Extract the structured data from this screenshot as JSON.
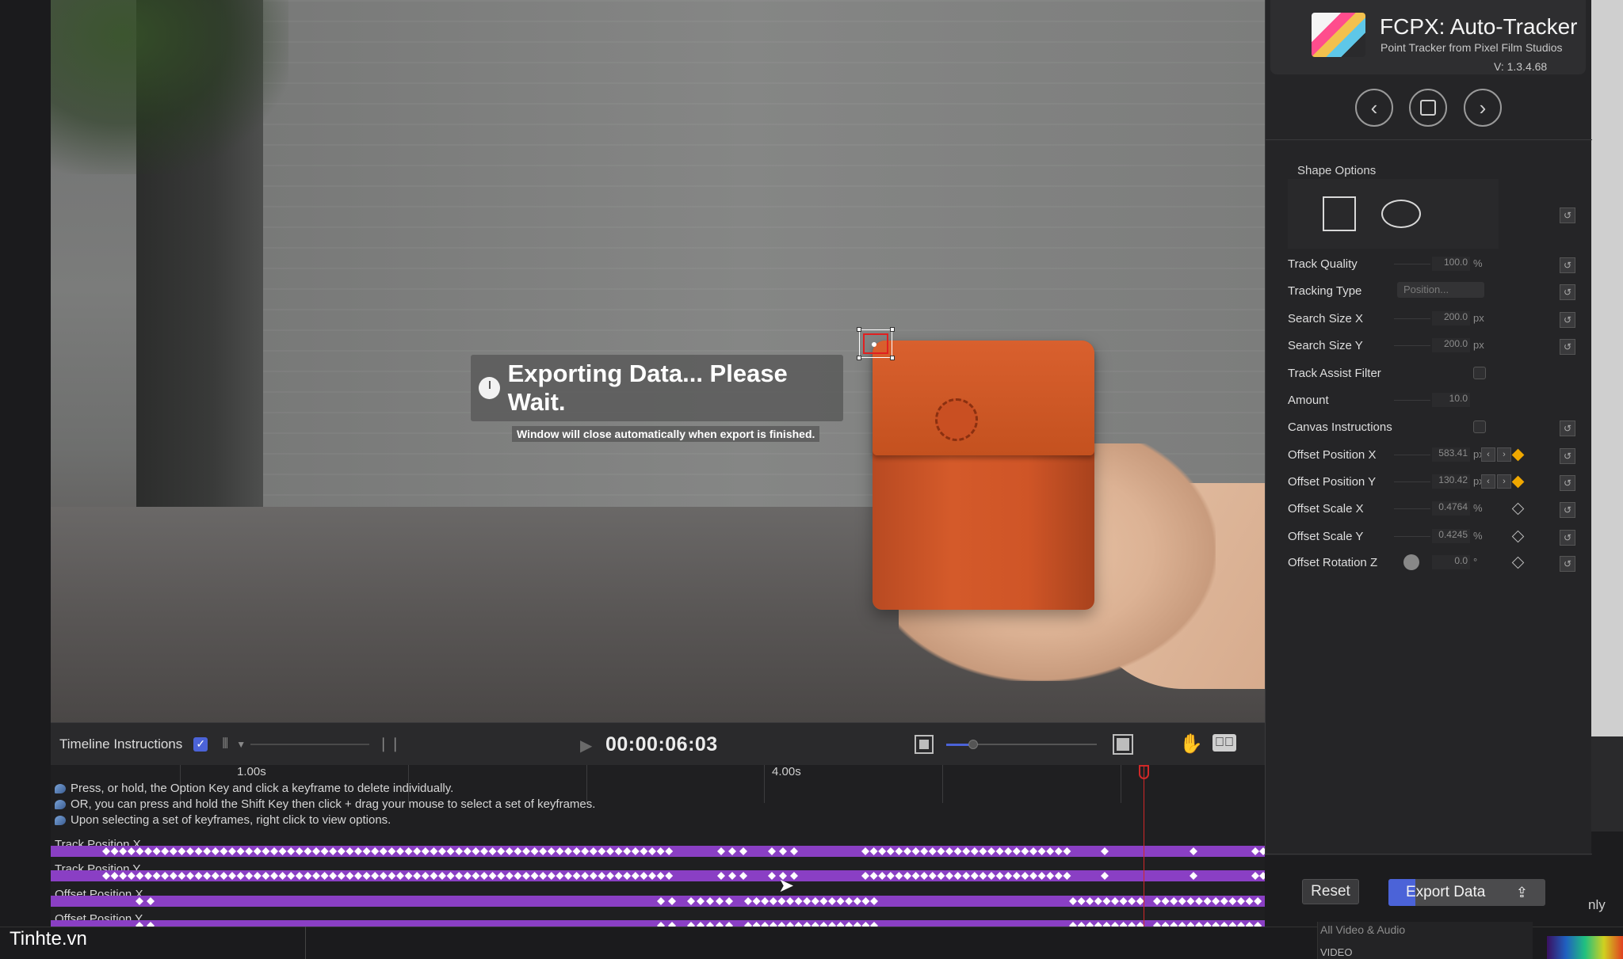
{
  "viewer": {
    "export_title": "Exporting Data... Please Wait.",
    "export_subtitle": "Window will close automatically when export is finished."
  },
  "timeline": {
    "label": "Timeline Instructions",
    "checkbox_checked": true,
    "timecode": "00:00:06:03",
    "zoom_level": 0.18,
    "ruler_labels": [
      "1.00s",
      "4.00s"
    ],
    "instructions": [
      "Press, or hold, the Option Key and click a keyframe to delete individually.",
      "OR, you can press and hold the Shift Key then click + drag your mouse to select a set of keyframes.",
      "Upon selecting a set of keyframes, right click to view options."
    ],
    "tracks": [
      {
        "label": "Track Position X"
      },
      {
        "label": "Track Position Y"
      },
      {
        "label": "Offset Position X"
      },
      {
        "label": "Offset Position Y"
      }
    ]
  },
  "panel": {
    "app_title": "FCPX: Auto-Tracker",
    "app_subtitle": "Point Tracker from Pixel Film Studios",
    "version": "V: 1.3.4.68",
    "shape_options_title": "Shape Options",
    "properties": {
      "track_quality": {
        "label": "Track Quality",
        "value": "100.0",
        "unit": "%"
      },
      "tracking_type": {
        "label": "Tracking Type",
        "value": "Position..."
      },
      "search_size_x": {
        "label": "Search Size X",
        "value": "200.0",
        "unit": "px"
      },
      "search_size_y": {
        "label": "Search Size Y",
        "value": "200.0",
        "unit": "px"
      },
      "track_assist_filter": {
        "label": "Track Assist Filter"
      },
      "amount": {
        "label": "Amount",
        "value": "10.0"
      },
      "canvas_instructions": {
        "label": "Canvas Instructions"
      },
      "offset_position_x": {
        "label": "Offset Position X",
        "value": "583.41",
        "unit": "px"
      },
      "offset_position_y": {
        "label": "Offset Position Y",
        "value": "130.42",
        "unit": "px"
      },
      "offset_scale_x": {
        "label": "Offset Scale X",
        "value": "0.4764",
        "unit": "%"
      },
      "offset_scale_y": {
        "label": "Offset Scale Y",
        "value": "0.4245",
        "unit": "%"
      },
      "offset_rotation_z": {
        "label": "Offset Rotation Z",
        "value": "0.0",
        "unit": "°"
      }
    },
    "reset_label": "Reset",
    "export_label": "Export Data",
    "export_progress": 0.17
  },
  "background": {
    "watermark": "Tinhte.vn",
    "library_item_1": "All Video & Audio",
    "library_item_2": "VIDEO",
    "partial_text": "nly"
  },
  "colors": {
    "accent_blue": "#4b63d8",
    "keyframe_track": "#8a3fc4",
    "keyframe_on": "#f0a800",
    "playhead": "#d02828"
  }
}
